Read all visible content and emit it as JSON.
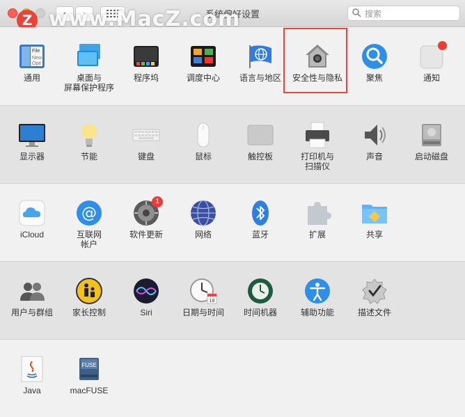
{
  "window": {
    "title": "系统偏好设置"
  },
  "search": {
    "placeholder": "搜索"
  },
  "watermark": {
    "text": "www.MacZ.com",
    "logo": "Z"
  },
  "rows": [
    {
      "items": [
        {
          "name": "通用",
          "line2": "",
          "icon": "general-icon"
        },
        {
          "name": "桌面与",
          "line2": "屏幕保护程序",
          "icon": "desktop-screensaver-icon"
        },
        {
          "name": "程序坞",
          "line2": "",
          "icon": "dock-icon"
        },
        {
          "name": "调度中心",
          "line2": "",
          "icon": "mission-control-icon"
        },
        {
          "name": "语言与地区",
          "line2": "",
          "icon": "language-region-icon"
        },
        {
          "name": "安全性与隐私",
          "line2": "",
          "icon": "security-privacy-icon"
        },
        {
          "name": "聚焦",
          "line2": "",
          "icon": "spotlight-icon"
        },
        {
          "name": "通知",
          "line2": "",
          "icon": "notifications-icon"
        }
      ]
    },
    {
      "items": [
        {
          "name": "显示器",
          "line2": "",
          "icon": "displays-icon"
        },
        {
          "name": "节能",
          "line2": "",
          "icon": "energy-saver-icon"
        },
        {
          "name": "键盘",
          "line2": "",
          "icon": "keyboard-icon"
        },
        {
          "name": "鼠标",
          "line2": "",
          "icon": "mouse-icon"
        },
        {
          "name": "触控板",
          "line2": "",
          "icon": "trackpad-icon"
        },
        {
          "name": "打印机与",
          "line2": "扫描仪",
          "icon": "printer-icon"
        },
        {
          "name": "声音",
          "line2": "",
          "icon": "sound-icon"
        },
        {
          "name": "启动磁盘",
          "line2": "",
          "icon": "startup-disk-icon"
        }
      ]
    },
    {
      "items": [
        {
          "name": "iCloud",
          "line2": "",
          "icon": "icloud-icon"
        },
        {
          "name": "互联网",
          "line2": "帐户",
          "icon": "internet-accounts-icon"
        },
        {
          "name": "软件更新",
          "line2": "",
          "icon": "software-update-icon",
          "badge": "1"
        },
        {
          "name": "网络",
          "line2": "",
          "icon": "network-icon"
        },
        {
          "name": "蓝牙",
          "line2": "",
          "icon": "bluetooth-icon"
        },
        {
          "name": "扩展",
          "line2": "",
          "icon": "extensions-icon"
        },
        {
          "name": "共享",
          "line2": "",
          "icon": "sharing-icon"
        }
      ]
    },
    {
      "items": [
        {
          "name": "用户与群组",
          "line2": "",
          "icon": "users-groups-icon"
        },
        {
          "name": "家长控制",
          "line2": "",
          "icon": "parental-controls-icon"
        },
        {
          "name": "Siri",
          "line2": "",
          "icon": "siri-icon"
        },
        {
          "name": "日期与时间",
          "line2": "",
          "icon": "date-time-icon"
        },
        {
          "name": "时间机器",
          "line2": "",
          "icon": "time-machine-icon"
        },
        {
          "name": "辅助功能",
          "line2": "",
          "icon": "accessibility-icon"
        },
        {
          "name": "描述文件",
          "line2": "",
          "icon": "profiles-icon"
        }
      ]
    },
    {
      "items": [
        {
          "name": "Java",
          "line2": "",
          "icon": "java-icon"
        },
        {
          "name": "macFUSE",
          "line2": "",
          "icon": "macfuse-icon"
        }
      ]
    }
  ],
  "colors": {
    "highlight": "#e8453c",
    "badge": "#ef3b36"
  }
}
